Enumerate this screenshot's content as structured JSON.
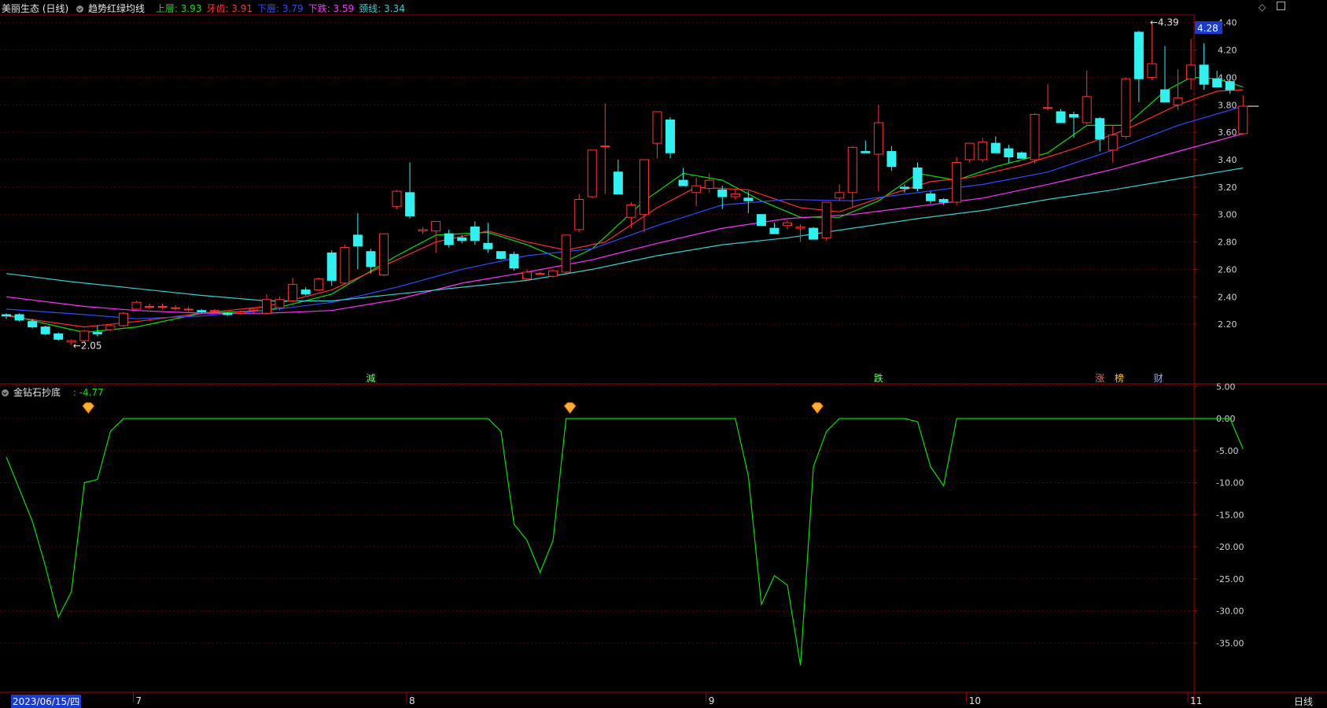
{
  "header": {
    "stock_name": "美丽生态 (日线)",
    "indicator_name": "趋势红绿均线",
    "lines": [
      {
        "label": "上層:",
        "value": "3.93",
        "color": "#00e000"
      },
      {
        "label": "牙齿:",
        "value": "3.91",
        "color": "#ff2d2d"
      },
      {
        "label": "下層:",
        "value": "3.79",
        "color": "#2d4bff"
      },
      {
        "label": "下跌:",
        "value": "3.59",
        "color": "#ff30ff"
      },
      {
        "label": "颈线:",
        "value": "3.34",
        "color": "#30d0d0"
      }
    ]
  },
  "price_panel": {
    "current_price_tag": "4.28",
    "high_label": "4.39",
    "low_label": "2.05",
    "markers": [
      {
        "text": "減",
        "color": "#66ff66",
        "x_index": 28
      },
      {
        "text": "跌",
        "color": "#66ff66",
        "x_index": 67
      },
      {
        "text": "涨",
        "color": "#ff6060",
        "x_index": 84
      },
      {
        "text": "榜",
        "color": "#ffcc00",
        "x_index": 85.5
      },
      {
        "text": "财",
        "color": "#8ab4ff",
        "x_index": 88.5
      }
    ]
  },
  "sub_panel": {
    "indicator_name": "金钻石抄底",
    "value_label": ": -4.77",
    "diamond_icons": [
      6,
      43,
      62
    ]
  },
  "bottom_axis": {
    "start_date": "2023/06/15/四",
    "month_labels": [
      {
        "text": "7",
        "x_index": 10
      },
      {
        "text": "8",
        "x_index": 31
      },
      {
        "text": "9",
        "x_index": 54
      },
      {
        "text": "10",
        "x_index": 74
      },
      {
        "text": "11",
        "x_index": 91
      }
    ],
    "period": "日线"
  },
  "chart_data": {
    "type": "candlestick",
    "y_ticks": [
      "4.40",
      "4.20",
      "4.00",
      "3.80",
      "3.60",
      "3.40",
      "3.20",
      "3.00",
      "2.80",
      "2.60",
      "2.40",
      "2.20"
    ],
    "ylim": [
      2.0,
      4.45
    ],
    "candles": [
      [
        2.27,
        2.28,
        2.24,
        2.26
      ],
      [
        2.27,
        2.28,
        2.22,
        2.23
      ],
      [
        2.22,
        2.24,
        2.17,
        2.18
      ],
      [
        2.18,
        2.19,
        2.12,
        2.13
      ],
      [
        2.13,
        2.14,
        2.08,
        2.09
      ],
      [
        2.07,
        2.09,
        2.05,
        2.08
      ],
      [
        2.08,
        2.16,
        2.07,
        2.15
      ],
      [
        2.14,
        2.19,
        2.11,
        2.13
      ],
      [
        2.16,
        2.2,
        2.15,
        2.19
      ],
      [
        2.19,
        2.29,
        2.18,
        2.28
      ],
      [
        2.31,
        2.37,
        2.3,
        2.36
      ],
      [
        2.33,
        2.35,
        2.31,
        2.33
      ],
      [
        2.33,
        2.35,
        2.31,
        2.33
      ],
      [
        2.32,
        2.34,
        2.3,
        2.32
      ],
      [
        2.31,
        2.33,
        2.29,
        2.31
      ],
      [
        2.3,
        2.31,
        2.28,
        2.29
      ],
      [
        2.3,
        2.31,
        2.28,
        2.3
      ],
      [
        2.28,
        2.29,
        2.26,
        2.27
      ],
      [
        2.28,
        2.3,
        2.27,
        2.29
      ],
      [
        2.3,
        2.32,
        2.28,
        2.31
      ],
      [
        2.28,
        2.42,
        2.27,
        2.38
      ],
      [
        2.32,
        2.4,
        2.3,
        2.38
      ],
      [
        2.37,
        2.54,
        2.36,
        2.49
      ],
      [
        2.45,
        2.47,
        2.41,
        2.42
      ],
      [
        2.45,
        2.54,
        2.44,
        2.53
      ],
      [
        2.72,
        2.74,
        2.48,
        2.52
      ],
      [
        2.5,
        2.78,
        2.49,
        2.76
      ],
      [
        2.85,
        3.01,
        2.6,
        2.77
      ],
      [
        2.73,
        2.75,
        2.57,
        2.62
      ],
      [
        2.56,
        2.86,
        2.55,
        2.86
      ],
      [
        3.06,
        3.18,
        3.04,
        3.17
      ],
      [
        3.16,
        3.38,
        2.97,
        2.99
      ],
      [
        2.88,
        2.91,
        2.86,
        2.89
      ],
      [
        2.88,
        2.95,
        2.72,
        2.95
      ],
      [
        2.86,
        2.89,
        2.76,
        2.78
      ],
      [
        2.83,
        2.85,
        2.79,
        2.81
      ],
      [
        2.91,
        2.95,
        2.78,
        2.81
      ],
      [
        2.79,
        2.94,
        2.72,
        2.75
      ],
      [
        2.73,
        2.73,
        2.67,
        2.68
      ],
      [
        2.71,
        2.73,
        2.59,
        2.61
      ],
      [
        2.53,
        2.6,
        2.52,
        2.58
      ],
      [
        2.57,
        2.58,
        2.56,
        2.57
      ],
      [
        2.55,
        2.6,
        2.54,
        2.59
      ],
      [
        2.58,
        2.85,
        2.57,
        2.85
      ],
      [
        2.89,
        3.15,
        2.87,
        3.11
      ],
      [
        3.13,
        3.47,
        3.12,
        3.47
      ],
      [
        3.5,
        3.81,
        3.15,
        3.5
      ],
      [
        3.31,
        3.4,
        3.15,
        3.15
      ],
      [
        2.98,
        3.09,
        2.9,
        3.07
      ],
      [
        3.0,
        3.4,
        2.87,
        3.4
      ],
      [
        3.52,
        3.75,
        3.41,
        3.75
      ],
      [
        3.69,
        3.71,
        3.41,
        3.45
      ],
      [
        3.25,
        3.34,
        3.21,
        3.21
      ],
      [
        3.16,
        3.27,
        3.06,
        3.21
      ],
      [
        3.19,
        3.3,
        3.16,
        3.25
      ],
      [
        3.18,
        3.21,
        3.04,
        3.13
      ],
      [
        3.13,
        3.18,
        3.11,
        3.15
      ],
      [
        3.12,
        3.17,
        3.01,
        3.1
      ],
      [
        3.0,
        3.0,
        2.92,
        2.92
      ],
      [
        2.9,
        2.94,
        2.86,
        2.86
      ],
      [
        2.92,
        2.96,
        2.89,
        2.94
      ],
      [
        2.9,
        2.93,
        2.8,
        2.91
      ],
      [
        2.9,
        2.91,
        2.82,
        2.82
      ],
      [
        2.83,
        3.09,
        2.81,
        3.09
      ],
      [
        3.12,
        3.22,
        3.1,
        3.16
      ],
      [
        3.16,
        3.5,
        3.05,
        3.49
      ],
      [
        3.46,
        3.54,
        3.45,
        3.45
      ],
      [
        3.44,
        3.8,
        3.17,
        3.67
      ],
      [
        3.46,
        3.5,
        3.32,
        3.35
      ],
      [
        3.2,
        3.22,
        3.16,
        3.19
      ],
      [
        3.34,
        3.38,
        3.17,
        3.19
      ],
      [
        3.15,
        3.17,
        3.08,
        3.1
      ],
      [
        3.11,
        3.12,
        3.07,
        3.09
      ],
      [
        3.09,
        3.42,
        3.07,
        3.38
      ],
      [
        3.4,
        3.52,
        3.38,
        3.52
      ],
      [
        3.4,
        3.56,
        3.38,
        3.53
      ],
      [
        3.52,
        3.57,
        3.46,
        3.45
      ],
      [
        3.48,
        3.51,
        3.37,
        3.42
      ],
      [
        3.45,
        3.46,
        3.41,
        3.41
      ],
      [
        3.4,
        3.74,
        3.37,
        3.73
      ],
      [
        3.78,
        3.95,
        3.76,
        3.78
      ],
      [
        3.75,
        3.77,
        3.71,
        3.67
      ],
      [
        3.73,
        3.75,
        3.56,
        3.71
      ],
      [
        3.67,
        4.05,
        3.66,
        3.86
      ],
      [
        3.7,
        3.71,
        3.46,
        3.55
      ],
      [
        3.47,
        3.65,
        3.38,
        3.58
      ],
      [
        3.57,
        4.0,
        3.55,
        3.99
      ],
      [
        4.33,
        4.34,
        3.82,
        3.99
      ],
      [
        4.0,
        4.39,
        3.98,
        4.1
      ],
      [
        3.91,
        4.23,
        3.83,
        3.82
      ],
      [
        3.8,
        4.06,
        3.76,
        3.85
      ],
      [
        3.99,
        4.28,
        3.91,
        4.09
      ],
      [
        4.09,
        4.25,
        3.91,
        3.95
      ],
      [
        3.99,
        4.05,
        3.95,
        3.93
      ],
      [
        3.97,
        4.02,
        3.88,
        3.91
      ],
      [
        3.59,
        3.87,
        3.58,
        3.79
      ]
    ],
    "ma_lines": [
      {
        "name": "上層",
        "color": "#00e000",
        "points": [
          [
            0,
            2.27
          ],
          [
            6,
            2.14
          ],
          [
            10,
            2.18
          ],
          [
            15,
            2.28
          ],
          [
            20,
            2.3
          ],
          [
            25,
            2.42
          ],
          [
            30,
            2.7
          ],
          [
            33,
            2.85
          ],
          [
            37,
            2.87
          ],
          [
            40,
            2.78
          ],
          [
            43,
            2.66
          ],
          [
            45,
            2.75
          ],
          [
            49,
            3.1
          ],
          [
            52,
            3.3
          ],
          [
            55,
            3.25
          ],
          [
            58,
            3.1
          ],
          [
            61,
            2.98
          ],
          [
            64,
            2.98
          ],
          [
            67,
            3.1
          ],
          [
            70,
            3.3
          ],
          [
            73,
            3.25
          ],
          [
            76,
            3.35
          ],
          [
            80,
            3.45
          ],
          [
            83,
            3.65
          ],
          [
            86,
            3.65
          ],
          [
            89,
            3.9
          ],
          [
            91,
            4.0
          ],
          [
            93,
            3.99
          ],
          [
            95,
            3.93
          ]
        ]
      },
      {
        "name": "牙齿",
        "color": "#ff2d2d",
        "points": [
          [
            0,
            2.26
          ],
          [
            6,
            2.18
          ],
          [
            10,
            2.22
          ],
          [
            15,
            2.28
          ],
          [
            20,
            2.33
          ],
          [
            25,
            2.45
          ],
          [
            30,
            2.67
          ],
          [
            33,
            2.8
          ],
          [
            37,
            2.88
          ],
          [
            40,
            2.8
          ],
          [
            43,
            2.74
          ],
          [
            46,
            2.8
          ],
          [
            50,
            3.05
          ],
          [
            53,
            3.2
          ],
          [
            57,
            3.18
          ],
          [
            61,
            3.05
          ],
          [
            64,
            3.02
          ],
          [
            68,
            3.15
          ],
          [
            71,
            3.24
          ],
          [
            74,
            3.27
          ],
          [
            78,
            3.36
          ],
          [
            82,
            3.48
          ],
          [
            86,
            3.62
          ],
          [
            90,
            3.8
          ],
          [
            93,
            3.9
          ],
          [
            95,
            3.91
          ]
        ]
      },
      {
        "name": "下層",
        "color": "#2d4bff",
        "points": [
          [
            0,
            2.31
          ],
          [
            6,
            2.27
          ],
          [
            10,
            2.24
          ],
          [
            15,
            2.26
          ],
          [
            20,
            2.3
          ],
          [
            25,
            2.36
          ],
          [
            30,
            2.47
          ],
          [
            35,
            2.6
          ],
          [
            40,
            2.7
          ],
          [
            45,
            2.75
          ],
          [
            50,
            2.92
          ],
          [
            55,
            3.07
          ],
          [
            60,
            3.11
          ],
          [
            65,
            3.1
          ],
          [
            70,
            3.16
          ],
          [
            75,
            3.22
          ],
          [
            80,
            3.31
          ],
          [
            85,
            3.47
          ],
          [
            90,
            3.65
          ],
          [
            95,
            3.79
          ]
        ]
      },
      {
        "name": "下跌",
        "color": "#ff30ff",
        "points": [
          [
            0,
            2.4
          ],
          [
            6,
            2.33
          ],
          [
            10,
            2.3
          ],
          [
            15,
            2.28
          ],
          [
            20,
            2.28
          ],
          [
            25,
            2.3
          ],
          [
            30,
            2.38
          ],
          [
            35,
            2.5
          ],
          [
            40,
            2.58
          ],
          [
            45,
            2.67
          ],
          [
            50,
            2.79
          ],
          [
            55,
            2.9
          ],
          [
            60,
            2.97
          ],
          [
            65,
            3.0
          ],
          [
            70,
            3.06
          ],
          [
            75,
            3.12
          ],
          [
            80,
            3.22
          ],
          [
            85,
            3.33
          ],
          [
            90,
            3.46
          ],
          [
            95,
            3.59
          ]
        ]
      },
      {
        "name": "颈线",
        "color": "#30d0d0",
        "points": [
          [
            0,
            2.57
          ],
          [
            5,
            2.51
          ],
          [
            10,
            2.46
          ],
          [
            15,
            2.41
          ],
          [
            20,
            2.37
          ],
          [
            25,
            2.37
          ],
          [
            30,
            2.42
          ],
          [
            35,
            2.47
          ],
          [
            40,
            2.52
          ],
          [
            45,
            2.6
          ],
          [
            50,
            2.7
          ],
          [
            55,
            2.78
          ],
          [
            60,
            2.83
          ],
          [
            65,
            2.9
          ],
          [
            70,
            2.97
          ],
          [
            75,
            3.03
          ],
          [
            80,
            3.11
          ],
          [
            85,
            3.18
          ],
          [
            90,
            3.26
          ],
          [
            95,
            3.34
          ]
        ]
      }
    ],
    "sub_y_ticks": [
      "5.00",
      "0.00",
      "-5.00",
      "-10.00",
      "-15.00",
      "-20.00",
      "-25.00",
      "-30.00",
      "-35.00"
    ],
    "sub_ylim": [
      -40,
      7
    ],
    "sub_series": [
      [
        0,
        -6
      ],
      [
        1,
        -11
      ],
      [
        2,
        -16
      ],
      [
        3,
        -23
      ],
      [
        4,
        -31
      ],
      [
        5,
        -27
      ],
      [
        6,
        -10
      ],
      [
        7,
        -9.5
      ],
      [
        8,
        -2
      ],
      [
        9,
        0
      ],
      [
        10,
        0
      ],
      [
        20,
        0
      ],
      [
        30,
        0
      ],
      [
        37,
        0
      ],
      [
        38,
        -2
      ],
      [
        39,
        -16.5
      ],
      [
        40,
        -19
      ],
      [
        41,
        -24
      ],
      [
        42,
        -19
      ],
      [
        43,
        0
      ],
      [
        44,
        0
      ],
      [
        50,
        0
      ],
      [
        56,
        0
      ],
      [
        57,
        -9
      ],
      [
        58,
        -29
      ],
      [
        59,
        -24.5
      ],
      [
        60,
        -26
      ],
      [
        61,
        -38.5
      ],
      [
        62,
        -7.5
      ],
      [
        63,
        -2
      ],
      [
        64,
        0
      ],
      [
        69,
        0
      ],
      [
        70,
        -0.5
      ],
      [
        71,
        -7.5
      ],
      [
        72,
        -10.5
      ],
      [
        73,
        0
      ],
      [
        80,
        0
      ],
      [
        94,
        0
      ],
      [
        95,
        -4.77
      ]
    ]
  }
}
